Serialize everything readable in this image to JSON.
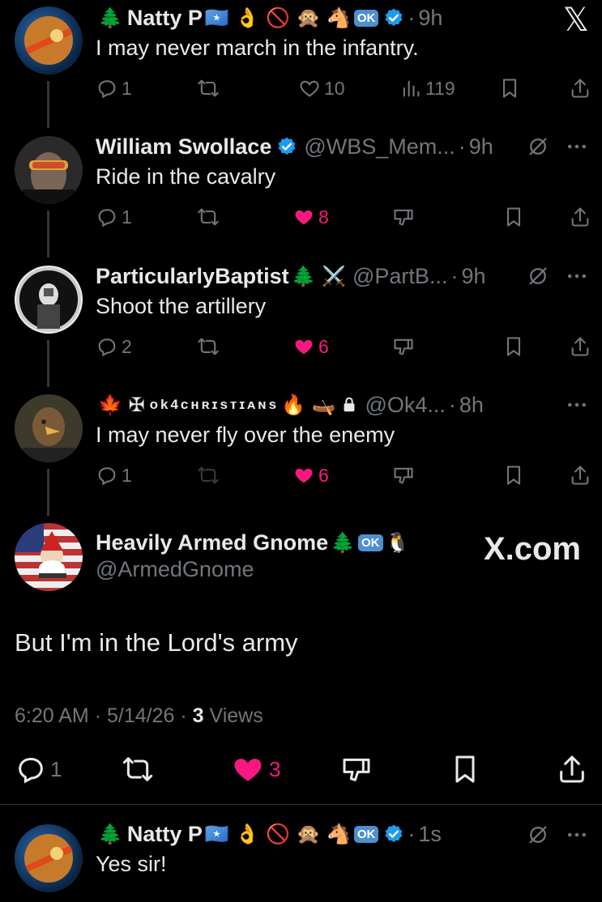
{
  "replies": [
    {
      "prefix_emoji": "🌲",
      "name": "Natty P",
      "suffix": "🇸🇴 👌 🚫 🙊 🐴",
      "ok": "OK",
      "handle": "",
      "time": "9h",
      "text": "I may never march in the infantry.",
      "reply_count": "1",
      "retweet_count": "",
      "like_count": "10",
      "views_count": "119",
      "liked": false,
      "has_views": true
    },
    {
      "prefix_emoji": "",
      "name": "William Swollace",
      "suffix": "",
      "ok": "",
      "handle": "@WBS_Mem...",
      "time": "9h",
      "text": "Ride in the cavalry",
      "reply_count": "1",
      "retweet_count": "",
      "like_count": "8",
      "liked": true,
      "has_views": false
    },
    {
      "prefix_emoji": "",
      "name": "ParticularlyBaptist",
      "suffix": "🌲 ⚔️",
      "ok": "",
      "handle": "@PartB...",
      "time": "9h",
      "text": "Shoot the artillery",
      "reply_count": "2",
      "retweet_count": "",
      "like_count": "6",
      "liked": true,
      "has_views": false
    },
    {
      "prefix_emoji": "🍁 ✠",
      "name": "ok4ᴄʜʀɪsᴛɪᴀɴs",
      "suffix": "🔥 🛶",
      "ok": "",
      "handle": "@Ok4...",
      "time": "8h",
      "text": "I may never fly over the enemy",
      "reply_count": "1",
      "retweet_count": "",
      "like_count": "6",
      "liked": true,
      "has_views": false
    }
  ],
  "x_logo": "𝕏",
  "main": {
    "name": "Heavily Armed Gnome",
    "suffix": "🌲",
    "ok": "OK",
    "suffix2": "🐧",
    "handle": "@ArmedGnome",
    "watermark": "X.com",
    "text": "But I'm in the Lord's army",
    "time": "6:20 AM",
    "date": "5/14/26",
    "views_count": "3",
    "views_label": "Views",
    "reply_count": "1",
    "like_count": "3"
  },
  "last": {
    "prefix_emoji": "🌲",
    "name": "Natty P",
    "suffix": "🇸🇴 👌 🚫 🙊 🐴",
    "ok": "OK",
    "time": "1s",
    "text": "Yes sir!"
  },
  "colors": {
    "background": "#000000",
    "text": "#e7e9ea",
    "muted": "#71767b",
    "like": "#f91880",
    "verified": "#1d9bf0"
  }
}
